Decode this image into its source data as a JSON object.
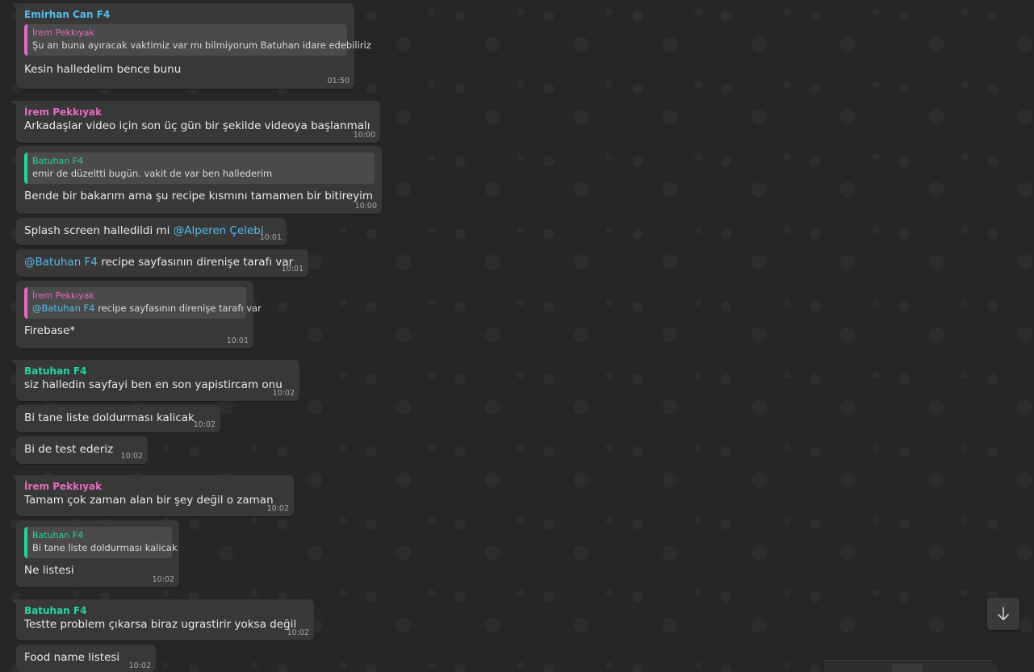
{
  "colors": {
    "emirhan": "#53bdeb",
    "irem": "#e66bc0",
    "batuhan": "#25d3a2",
    "mention": "#53bdeb"
  },
  "icons": {
    "scroll_down": "arrow-down-icon"
  },
  "messages": [
    {
      "sender": "Emirhan Can F4",
      "quote": {
        "name": "İrem Pekkıyak",
        "text": "Şu an buna ayıracak vaktimiz var mı bilmiyorum Batuhan idare edebiliriz"
      },
      "text": "Kesin halledelim bence bunu",
      "time": "01:50"
    },
    {
      "sender": "İrem Pekkıyak",
      "text": "Arkadaşlar video için son üç gün bir şekilde videoya başlanmalı",
      "time": "10:00"
    },
    {
      "quote": {
        "name": "Batuhan F4",
        "text": "emir de düzeltti bugün. vakit de var ben hallederim"
      },
      "text": "Bende bir bakarım ama şu recipe kısmını tamamen bir bitireyim",
      "time": "10:00"
    },
    {
      "text_before": "Splash screen halledildi mi ",
      "mention": "@Alperen Çelebi",
      "time": "10:01"
    },
    {
      "mention": "@Batuhan F4",
      "text_after": " recipe sayfasının direnişe tarafı var",
      "time": "10:01"
    },
    {
      "quote": {
        "name": "İrem Pekkıyak",
        "mention": "@Batuhan F4",
        "text": " recipe sayfasının direnişe tarafı var"
      },
      "text": "Firebase*",
      "time": "10:01"
    },
    {
      "sender": "Batuhan F4",
      "text": "siz halledin sayfayi ben en son yapistircam onu",
      "time": "10:02"
    },
    {
      "text": "Bi tane liste doldurması kalicak",
      "time": "10:02"
    },
    {
      "text": "Bi de test ederiz",
      "time": "10:02"
    },
    {
      "sender": "İrem Pekkıyak",
      "text": "Tamam çok zaman alan bir şey değil o zaman",
      "time": "10:02"
    },
    {
      "quote": {
        "name": "Batuhan F4",
        "text": "Bi tane liste doldurması kalicak"
      },
      "text": "Ne listesi",
      "time": "10:02"
    },
    {
      "sender": "Batuhan F4",
      "text": "Testte problem çıkarsa biraz ugrastirir yoksa değil",
      "time": "10:02"
    },
    {
      "text": "Food name listesi",
      "time": "10:02"
    }
  ]
}
